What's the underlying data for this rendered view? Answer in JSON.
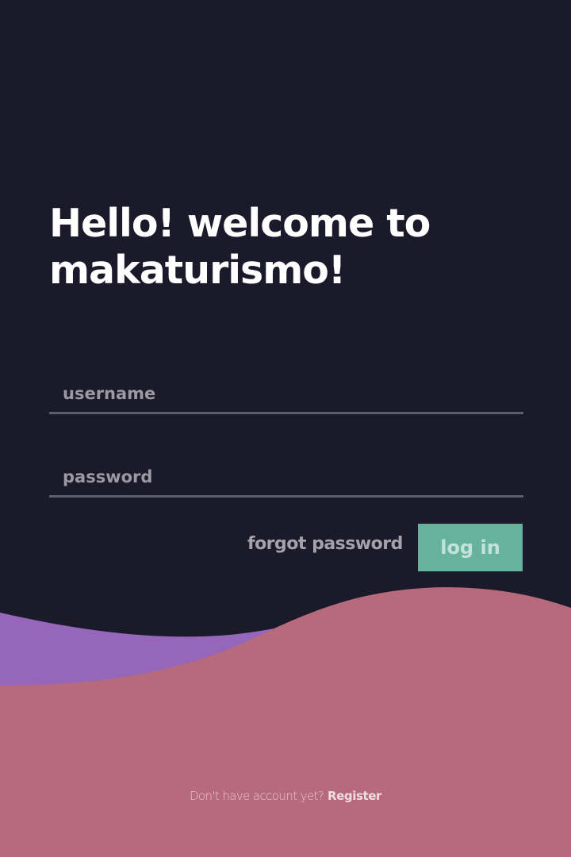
{
  "welcome": {
    "line1": "Hello! welcome to",
    "line2": "makaturismo!"
  },
  "form": {
    "username_placeholder": "username",
    "password_placeholder": "password",
    "forgot_label": "forgot password",
    "login_label": "log in"
  },
  "footer": {
    "prompt": "Don't have account yet?",
    "register_label": "Register"
  },
  "colors": {
    "background": "#1b1a2b",
    "accent_button": "#67b29d",
    "wave_front": "#b76a7c",
    "wave_back": "#9566ba",
    "input_underline": "#5d5c6c"
  }
}
